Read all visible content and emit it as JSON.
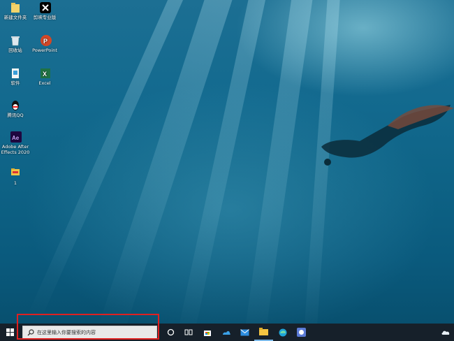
{
  "desktop": {
    "icons": [
      {
        "id": "new-folder",
        "label": "新建文件夹"
      },
      {
        "id": "capcut",
        "label": "剪映专业版"
      },
      {
        "id": "recycle-bin",
        "label": "回收站"
      },
      {
        "id": "powerpoint",
        "label": "PowerPoint"
      },
      {
        "id": "software",
        "label": "软件"
      },
      {
        "id": "excel",
        "label": "Excel"
      },
      {
        "id": "qq",
        "label": "腾讯QQ"
      },
      {
        "id": "after-effects",
        "label": "Adobe After Effects 2020"
      },
      {
        "id": "folder-1",
        "label": "1"
      }
    ]
  },
  "taskbar": {
    "search_placeholder": "在这里输入你要搜索的内容",
    "icons": [
      "windows-start-icon",
      "search-icon",
      "cortana-icon",
      "task-view-icon",
      "store-icon",
      "onedrive-app-icon",
      "mail-icon",
      "file-explorer-icon",
      "edge-icon",
      "app-icon",
      "cloud-tray-icon"
    ]
  },
  "colors": {
    "taskbar": "#16202a",
    "highlight": "#e02020",
    "water": "#0e6386"
  }
}
